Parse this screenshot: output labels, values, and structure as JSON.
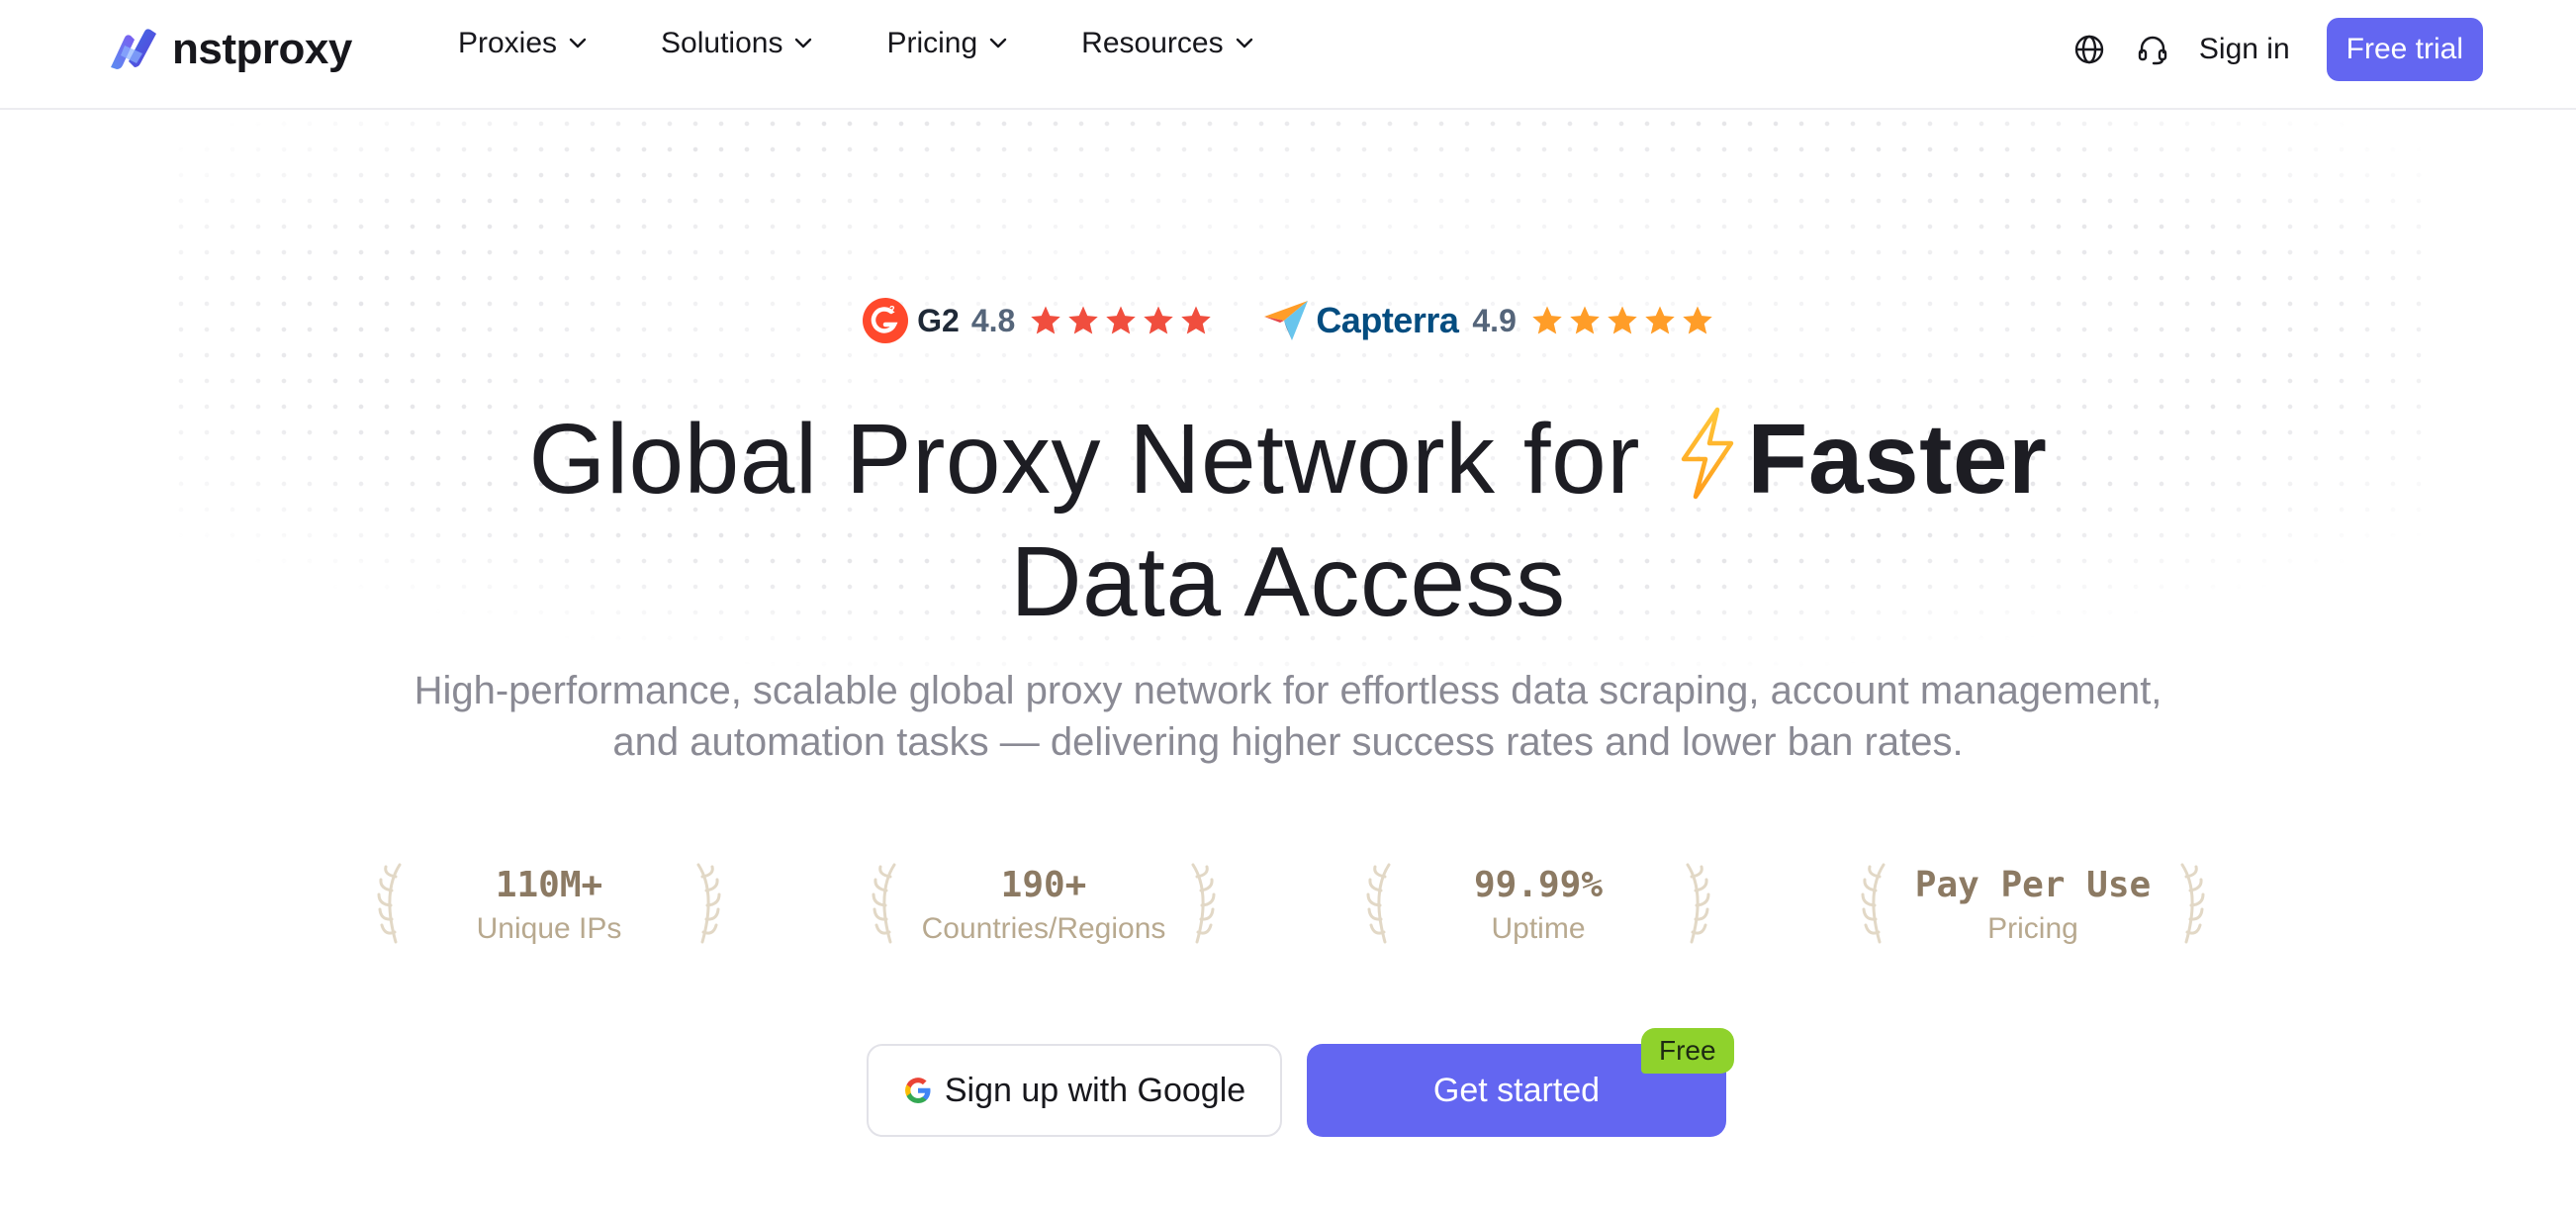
{
  "header": {
    "logo_text": "nstproxy",
    "nav": [
      {
        "label": "Proxies"
      },
      {
        "label": "Solutions"
      },
      {
        "label": "Pricing"
      },
      {
        "label": "Resources"
      }
    ],
    "tools": {
      "language_icon": "globe-icon",
      "support_icon": "headset-icon"
    },
    "sign_in": "Sign in",
    "free_trial": "Free trial"
  },
  "ratings": [
    {
      "brand": "G2",
      "score": "4.8",
      "stars": 5,
      "star_color": "#f04e3e"
    },
    {
      "brand": "Capterra",
      "score": "4.9",
      "stars": 5,
      "star_color": "#ff9d28"
    }
  ],
  "hero": {
    "title_part1": "Global Proxy Network for ",
    "title_bold": "Faster",
    "title_line2": "Data Access",
    "subtitle_line1": "High-performance, scalable global proxy network for effortless data scraping, account management,",
    "subtitle_line2": "and automation tasks — delivering higher success rates and lower ban rates."
  },
  "stats": [
    {
      "value": "110M+",
      "label": "Unique IPs"
    },
    {
      "value": "190+",
      "label": "Countries/Regions"
    },
    {
      "value": "99.99%",
      "label": "Uptime"
    },
    {
      "value": "Pay Per Use",
      "label": "Pricing"
    }
  ],
  "cta": {
    "google_label": "Sign up with Google",
    "start_label": "Get started",
    "badge": "Free"
  },
  "colors": {
    "accent": "#6366f1",
    "badge": "#8fd22c",
    "stat_text": "#8c7a63"
  }
}
